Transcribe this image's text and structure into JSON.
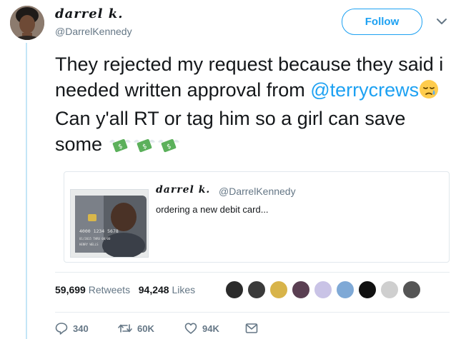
{
  "author": {
    "name": "darrel k.",
    "handle": "@DarrelKennedy"
  },
  "follow_label": "Follow",
  "tweet": {
    "text_1": "They rejected my request because they said i needed written approval from ",
    "mention": "@terrycrews",
    "text_2": " Can y'all RT or tag him so a girl can save some "
  },
  "quote": {
    "name": "darrel k.",
    "handle": "@DarrelKennedy",
    "text": "ordering a new debit card...",
    "card": {
      "number": "4000 1234 5678",
      "expiry": "01/2015 THRU 00/00",
      "holder": "HENRY WELLS"
    }
  },
  "stats": {
    "retweets_count": "59,699",
    "retweets_label": " Retweets",
    "likes_count": "94,248",
    "likes_label": " Likes"
  },
  "likers": [
    {
      "name": "liker-1",
      "color": "#2b2b2b"
    },
    {
      "name": "liker-2",
      "color": "#3a3a3a"
    },
    {
      "name": "liker-3",
      "color": "#d8b44a"
    },
    {
      "name": "liker-4",
      "color": "#5a3f52"
    },
    {
      "name": "liker-5",
      "color": "#c9c3e6"
    },
    {
      "name": "liker-6",
      "color": "#7fa9d6"
    },
    {
      "name": "liker-7",
      "color": "#111111"
    },
    {
      "name": "liker-8",
      "color": "#cfcfcf"
    },
    {
      "name": "liker-9",
      "color": "#555555"
    }
  ],
  "actions": {
    "reply_count": "340",
    "retweet_count": "60K",
    "like_count": "94K"
  },
  "colors": {
    "accent": "#1da1f2",
    "secondary_text": "#657786",
    "money_green": "#5bb05b"
  },
  "icons": {
    "caret": "chevron-down-icon",
    "emoji_sad": "sad-relieved-face-emoji",
    "emoji_money": "money-with-wings-emoji",
    "reply": "reply-icon",
    "retweet": "retweet-icon",
    "like": "heart-icon",
    "dm": "envelope-icon"
  }
}
